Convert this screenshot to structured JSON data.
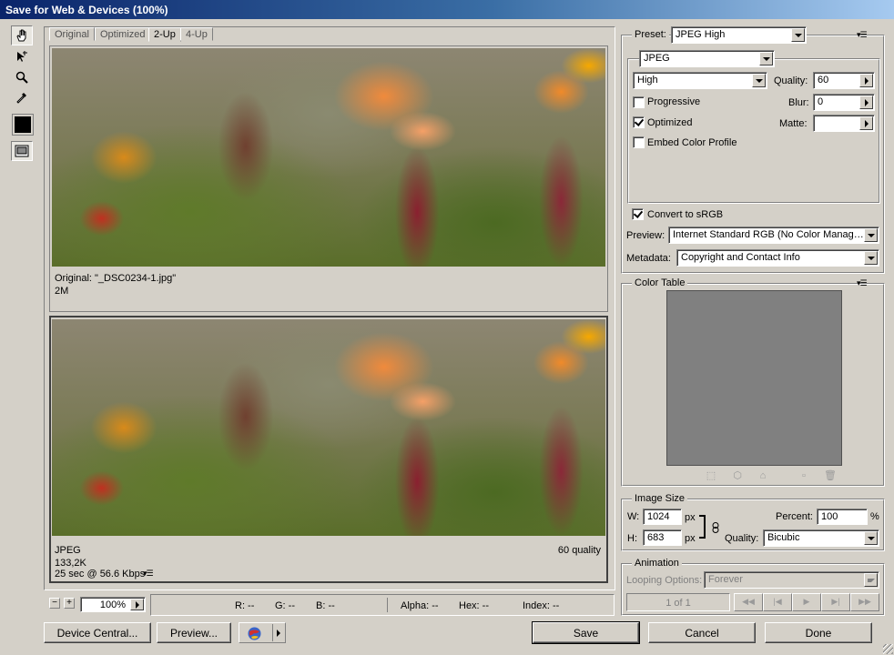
{
  "window": {
    "title": "Save for Web & Devices (100%)"
  },
  "tabs": [
    {
      "label": "Original"
    },
    {
      "label": "Optimized"
    },
    {
      "label": "2-Up"
    },
    {
      "label": "4-Up"
    }
  ],
  "original_panel": {
    "line1": "Original: \"_DSC0234-1.jpg\"",
    "line2": "2M"
  },
  "optimized_panel": {
    "format": "JPEG",
    "size": "133,2K",
    "download_time": "25 sec @ 56.6 Kbps",
    "quality_note": "60 quality"
  },
  "zoom": {
    "value": "100%"
  },
  "status": {
    "r": "R: --",
    "g": "G: --",
    "b": "B: --",
    "alpha": "Alpha: --",
    "hex": "Hex: --",
    "index": "Index: --"
  },
  "settings": {
    "preset_label": "Preset:",
    "preset_value": "JPEG High",
    "format_value": "JPEG",
    "compression_value": "High",
    "quality_label": "Quality:",
    "quality_value": "60",
    "blur_label": "Blur:",
    "blur_value": "0",
    "matte_label": "Matte:",
    "matte_value": "",
    "progressive_label": "Progressive",
    "progressive_checked": false,
    "optimized_label": "Optimized",
    "optimized_checked": true,
    "embed_label": "Embed Color Profile",
    "embed_checked": false,
    "srgb_label": "Convert to sRGB",
    "srgb_checked": true,
    "preview_label": "Preview:",
    "preview_value": "Internet Standard RGB (No Color Manag…",
    "metadata_label": "Metadata:",
    "metadata_value": "Copyright and Contact Info"
  },
  "color_table": {
    "title": "Color Table",
    "swatch_color": "#808080"
  },
  "image_size": {
    "title": "Image Size",
    "w_label": "W:",
    "w_value": "1024",
    "w_unit": "px",
    "h_label": "H:",
    "h_value": "683",
    "h_unit": "px",
    "percent_label": "Percent:",
    "percent_value": "100",
    "percent_unit": "%",
    "quality_label": "Quality:",
    "quality_value": "Bicubic"
  },
  "animation": {
    "title": "Animation",
    "looping_label": "Looping Options:",
    "looping_value": "Forever",
    "frame_counter": "1 of 1"
  },
  "buttons": {
    "device_central": "Device Central...",
    "preview": "Preview...",
    "save": "Save",
    "cancel": "Cancel",
    "done": "Done"
  }
}
